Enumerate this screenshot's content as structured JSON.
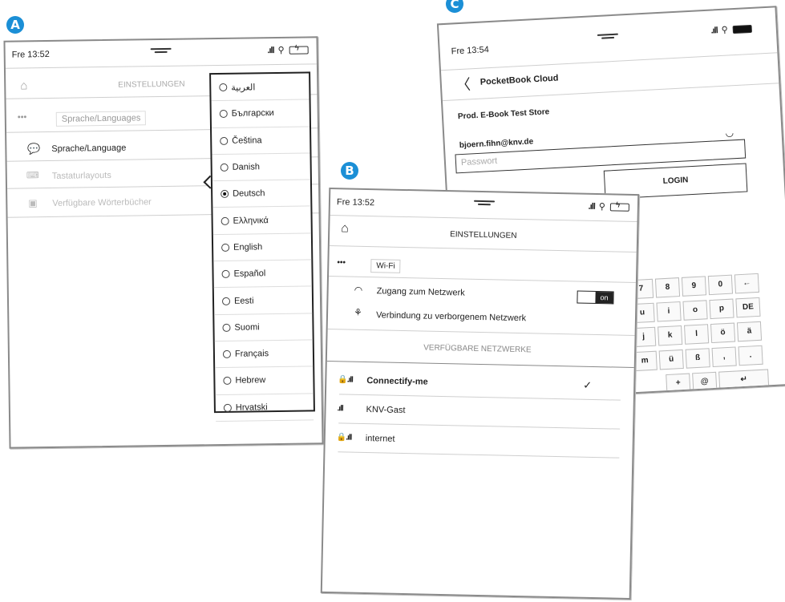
{
  "badges": {
    "a": "A",
    "b": "B",
    "c": "C"
  },
  "accent_color": "#1b8fd6",
  "screen_a": {
    "time": "Fre 13:52",
    "header_title": "EINSTELLUNGEN",
    "home_icon": "home-icon",
    "breadcrumb": {
      "more": "•••",
      "current": "Sprache/Languages"
    },
    "menu": [
      {
        "label": "Sprache/Language",
        "icon": "speech-bubble-icon",
        "active": true
      },
      {
        "label": "Tastaturlayouts",
        "icon": "keyboard-icon",
        "active": false
      },
      {
        "label": "Verfügbare Wörterbücher",
        "icon": "dictionary-icon",
        "active": false
      }
    ],
    "languages": [
      "العربية",
      "Български",
      "Čeština",
      "Danish",
      "Deutsch",
      "Ελληνικά",
      "English",
      "Español",
      "Eesti",
      "Suomi",
      "Français",
      "Hebrew",
      "Hrvatski"
    ],
    "selected_language": "Deutsch"
  },
  "screen_b": {
    "time": "Fre 13:52",
    "header_title": "EINSTELLUNGEN",
    "breadcrumb": {
      "more": "•••",
      "current": "Wi-Fi"
    },
    "wifi_access_label": "Zugang zum Netzwerk",
    "toggle_on": "on",
    "hidden_network_label": "Verbindung zu verborgenem Netzwerk",
    "section_title": "VERFÜGBARE NETZWERKE",
    "networks": [
      {
        "name": "Connectify-me",
        "secured": true,
        "connected": true
      },
      {
        "name": "KNV-Gast",
        "secured": false,
        "connected": false
      },
      {
        "name": "internet",
        "secured": true,
        "connected": false
      }
    ],
    "check_mark": "✓"
  },
  "screen_c": {
    "time": "Fre 13:54",
    "title": "PocketBook Cloud",
    "store": "Prod. E-Book Test Store",
    "email": "bjoern.fihn@knv.de",
    "password_placeholder": "Passwort",
    "login": "LOGIN",
    "keyboard": [
      [
        "7",
        "8",
        "9",
        "0",
        "←"
      ],
      [
        "u",
        "i",
        "o",
        "p",
        "DE"
      ],
      [
        "j",
        "k",
        "l",
        "ö",
        "ä"
      ],
      [
        "m",
        "ü",
        "ß",
        ",",
        "."
      ],
      [
        "+",
        "@",
        "↵"
      ]
    ]
  }
}
